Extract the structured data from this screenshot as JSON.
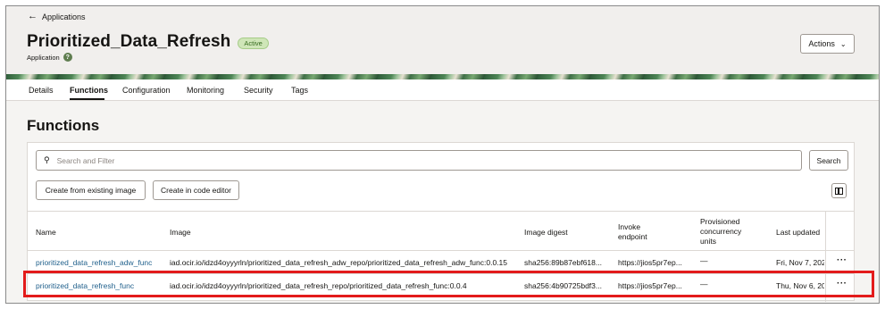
{
  "header": {
    "back_label": "Applications",
    "title": "Prioritized_Data_Refresh",
    "status": "Active",
    "subtitle": "Application",
    "actions_label": "Actions"
  },
  "tabs": [
    "Details",
    "Functions",
    "Configuration",
    "Monitoring",
    "Security",
    "Tags"
  ],
  "active_tab": "Functions",
  "section_title": "Functions",
  "search": {
    "placeholder": "Search and Filter",
    "button_label": "Search"
  },
  "toolbar": {
    "create_from_image": "Create from existing image",
    "create_in_editor": "Create in code editor"
  },
  "table": {
    "columns": {
      "name": "Name",
      "image": "Image",
      "digest": "Image digest",
      "endpoint_1": "Invoke",
      "endpoint_2": "endpoint",
      "prov_1": "Provisioned",
      "prov_2": "concurrency",
      "prov_3": "units",
      "updated": "Last updated"
    },
    "rows": [
      {
        "name": "prioritized_data_refresh_adw_func",
        "image": "iad.ocir.io/idzd4oyyyrln/prioritized_data_refresh_adw_repo/prioritized_data_refresh_adw_func:0.0.15",
        "digest": "sha256:89b87ebf618...",
        "endpoint": "https://jios5pr7ep...",
        "concurrency": "—",
        "updated": "Fri, Nov 7, 202",
        "menu": "···"
      },
      {
        "name": "prioritized_data_refresh_func",
        "image": "iad.ocir.io/idzd4oyyyrln/prioritized_data_refresh_repo/prioritized_data_refresh_func:0.0.4",
        "digest": "sha256:4b90725bdf3...",
        "endpoint": "https://jios5pr7ep...",
        "concurrency": "—",
        "updated": "Thu, Nov 6, 20",
        "menu": "···"
      }
    ]
  },
  "colors": {
    "accent_link": "#1f5f8b",
    "highlight": "#e31b1b",
    "status_badge": "#cfe6b8"
  },
  "icons": [
    "back-arrow-icon",
    "help-icon",
    "chevron-down-icon",
    "search-icon",
    "columns-icon",
    "more-actions-icon"
  ]
}
